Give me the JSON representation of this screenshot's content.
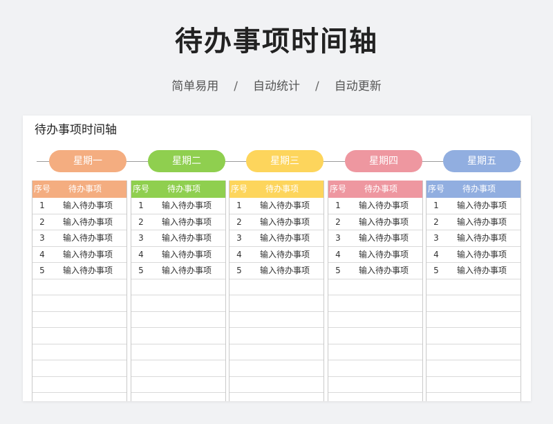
{
  "header": {
    "title": "待办事项时间轴",
    "subtitle": [
      "简单易用",
      "自动统计",
      "自动更新"
    ],
    "separator": "/"
  },
  "sheet": {
    "title": "待办事项时间轴",
    "columns": [
      {
        "day": "星期一",
        "color": "#f4ad80",
        "head_idx": "序号",
        "head_task": "待办事项",
        "rows": [
          {
            "idx": "1",
            "task": "输入待办事项"
          },
          {
            "idx": "2",
            "task": "输入待办事项"
          },
          {
            "idx": "3",
            "task": "输入待办事项"
          },
          {
            "idx": "4",
            "task": "输入待办事项"
          },
          {
            "idx": "5",
            "task": "输入待办事项"
          },
          {
            "idx": "",
            "task": ""
          },
          {
            "idx": "",
            "task": ""
          },
          {
            "idx": "",
            "task": ""
          },
          {
            "idx": "",
            "task": ""
          },
          {
            "idx": "",
            "task": ""
          },
          {
            "idx": "",
            "task": ""
          },
          {
            "idx": "",
            "task": ""
          }
        ]
      },
      {
        "day": "星期二",
        "color": "#8fcf4f",
        "head_idx": "序号",
        "head_task": "待办事项",
        "rows": [
          {
            "idx": "1",
            "task": "输入待办事项"
          },
          {
            "idx": "2",
            "task": "输入待办事项"
          },
          {
            "idx": "3",
            "task": "输入待办事项"
          },
          {
            "idx": "4",
            "task": "输入待办事项"
          },
          {
            "idx": "5",
            "task": "输入待办事项"
          },
          {
            "idx": "",
            "task": ""
          },
          {
            "idx": "",
            "task": ""
          },
          {
            "idx": "",
            "task": ""
          },
          {
            "idx": "",
            "task": ""
          },
          {
            "idx": "",
            "task": ""
          },
          {
            "idx": "",
            "task": ""
          },
          {
            "idx": "",
            "task": ""
          }
        ]
      },
      {
        "day": "星期三",
        "color": "#fdd55c",
        "head_idx": "序号",
        "head_task": "待办事项",
        "rows": [
          {
            "idx": "1",
            "task": "输入待办事项"
          },
          {
            "idx": "2",
            "task": "输入待办事项"
          },
          {
            "idx": "3",
            "task": "输入待办事项"
          },
          {
            "idx": "4",
            "task": "输入待办事项"
          },
          {
            "idx": "5",
            "task": "输入待办事项"
          },
          {
            "idx": "",
            "task": ""
          },
          {
            "idx": "",
            "task": ""
          },
          {
            "idx": "",
            "task": ""
          },
          {
            "idx": "",
            "task": ""
          },
          {
            "idx": "",
            "task": ""
          },
          {
            "idx": "",
            "task": ""
          },
          {
            "idx": "",
            "task": ""
          }
        ]
      },
      {
        "day": "星期四",
        "color": "#ee97a0",
        "head_idx": "序号",
        "head_task": "待办事项",
        "rows": [
          {
            "idx": "1",
            "task": "输入待办事项"
          },
          {
            "idx": "2",
            "task": "输入待办事项"
          },
          {
            "idx": "3",
            "task": "输入待办事项"
          },
          {
            "idx": "4",
            "task": "输入待办事项"
          },
          {
            "idx": "5",
            "task": "输入待办事项"
          },
          {
            "idx": "",
            "task": ""
          },
          {
            "idx": "",
            "task": ""
          },
          {
            "idx": "",
            "task": ""
          },
          {
            "idx": "",
            "task": ""
          },
          {
            "idx": "",
            "task": ""
          },
          {
            "idx": "",
            "task": ""
          },
          {
            "idx": "",
            "task": ""
          }
        ]
      },
      {
        "day": "星期五",
        "color": "#91aee0",
        "head_idx": "序号",
        "head_task": "待办事项",
        "rows": [
          {
            "idx": "1",
            "task": "输入待办事项"
          },
          {
            "idx": "2",
            "task": "输入待办事项"
          },
          {
            "idx": "3",
            "task": "输入待办事项"
          },
          {
            "idx": "4",
            "task": "输入待办事项"
          },
          {
            "idx": "5",
            "task": "输入待办事项"
          },
          {
            "idx": "",
            "task": ""
          },
          {
            "idx": "",
            "task": ""
          },
          {
            "idx": "",
            "task": ""
          },
          {
            "idx": "",
            "task": ""
          },
          {
            "idx": "",
            "task": ""
          },
          {
            "idx": "",
            "task": ""
          },
          {
            "idx": "",
            "task": ""
          }
        ]
      }
    ]
  }
}
